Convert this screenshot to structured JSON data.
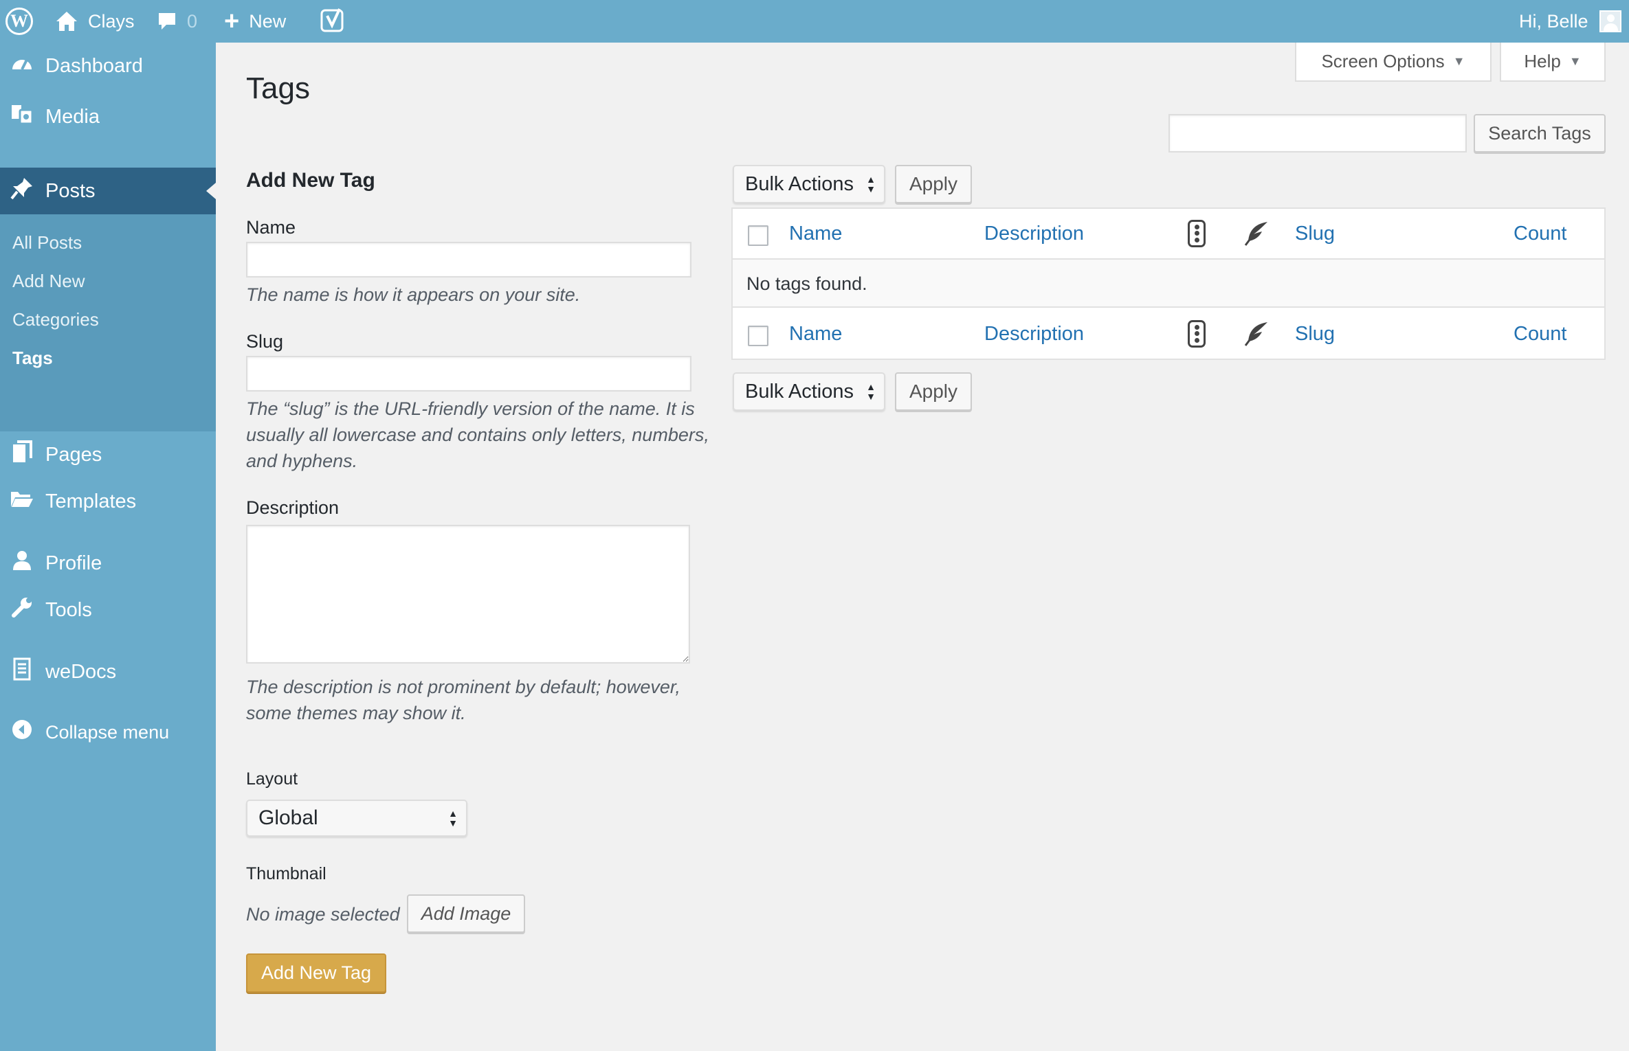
{
  "adminbar": {
    "site_name": "Clays",
    "comments_count": "0",
    "new_label": "New",
    "greeting": "Hi, Belle",
    "icons": [
      "wordpress-logo-icon",
      "home-icon",
      "comment-icon",
      "plus-icon",
      "yoast-icon",
      "avatar-icon"
    ]
  },
  "sidebar": {
    "items": [
      {
        "label": "Dashboard",
        "icon": "dashboard-icon"
      },
      {
        "label": "Media",
        "icon": "media-icon"
      },
      {
        "label": "Posts",
        "icon": "pin-icon",
        "current": true
      },
      {
        "label": "Pages",
        "icon": "pages-icon"
      },
      {
        "label": "Templates",
        "icon": "folder-icon"
      },
      {
        "label": "Profile",
        "icon": "user-icon"
      },
      {
        "label": "Tools",
        "icon": "wrench-icon"
      },
      {
        "label": "weDocs",
        "icon": "document-icon"
      },
      {
        "label": "Collapse menu",
        "icon": "collapse-icon"
      }
    ],
    "submenu": [
      "All Posts",
      "Add New",
      "Categories",
      "Tags"
    ],
    "submenu_current": "Tags"
  },
  "header": {
    "title": "Tags",
    "screen_options": "Screen Options",
    "help": "Help",
    "search_button": "Search Tags",
    "search_value": ""
  },
  "form": {
    "heading": "Add New Tag",
    "name_label": "Name",
    "name_value": "",
    "name_help": "The name is how it appears on your site.",
    "slug_label": "Slug",
    "slug_value": "",
    "slug_help": "The “slug” is the URL-friendly version of the name. It is usually all lowercase and contains only letters, numbers, and hyphens.",
    "description_label": "Description",
    "description_value": "",
    "description_help": "The description is not prominent by default; however, some themes may show it.",
    "layout_label": "Layout",
    "layout_selected": "Global",
    "thumbnail_label": "Thumbnail",
    "thumbnail_status": "No image selected",
    "add_image_button": "Add Image",
    "submit_button": "Add New Tag"
  },
  "table": {
    "bulk_actions": "Bulk Actions",
    "apply": "Apply",
    "columns": {
      "name": "Name",
      "description": "Description",
      "slug": "Slug",
      "count": "Count"
    },
    "column_icons": [
      "seo-score-icon",
      "readability-icon"
    ],
    "empty_message": "No tags found."
  },
  "colors": {
    "sidebar_bg": "#6aaccb",
    "sidebar_current": "#2e6285",
    "link": "#2271b1",
    "primary_button": "#d7a94b"
  }
}
